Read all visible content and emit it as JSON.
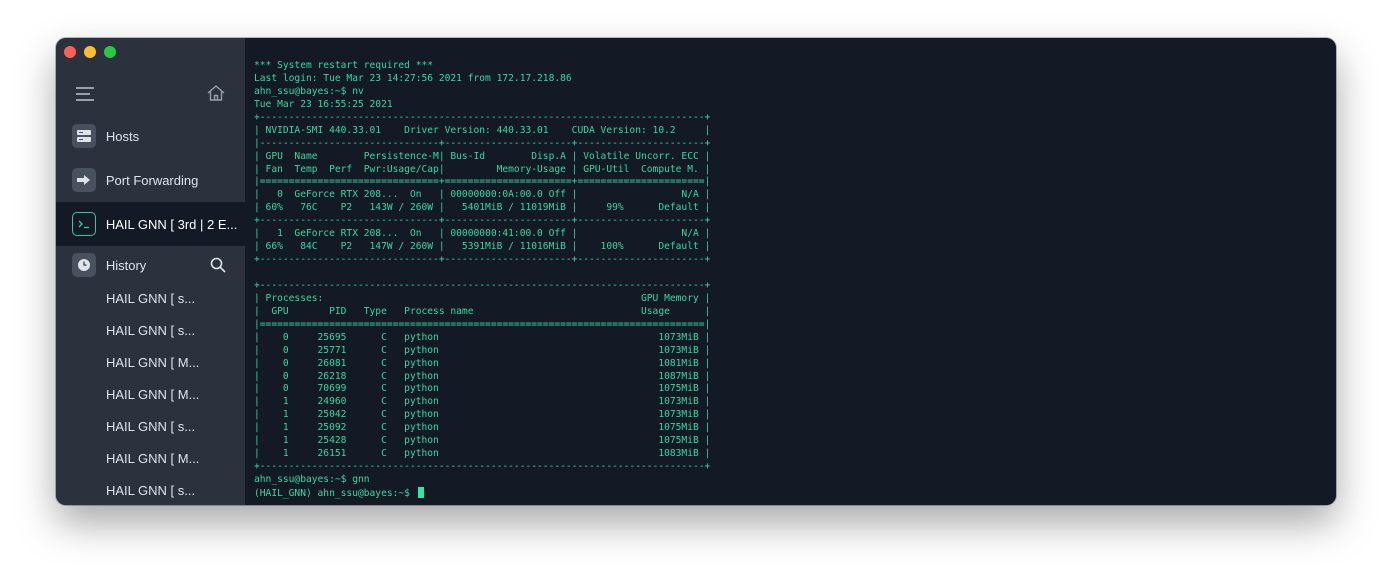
{
  "sidebar": {
    "nav": [
      {
        "label": "Hosts",
        "icon": "hosts-icon"
      },
      {
        "label": "Port Forwarding",
        "icon": "port-forwarding-icon"
      },
      {
        "label": "HAIL GNN [ 3rd | 2 E...",
        "icon": "terminal-icon",
        "active": true
      },
      {
        "label": "History",
        "icon": "history-icon"
      }
    ],
    "history": [
      "HAIL GNN [ s...",
      "HAIL GNN [ s...",
      "HAIL GNN [ M...",
      "HAIL GNN [ M...",
      "HAIL GNN [ s...",
      "HAIL GNN [ M...",
      "HAIL GNN [ s..."
    ]
  },
  "terminal": {
    "lines": [
      "*** System restart required ***",
      "Last login: Tue Mar 23 14:27:56 2021 from 172.17.218.86",
      "ahn_ssu@bayes:~$ nv",
      "Tue Mar 23 16:55:25 2021",
      "+-----------------------------------------------------------------------------+",
      "| NVIDIA-SMI 440.33.01    Driver Version: 440.33.01    CUDA Version: 10.2     |",
      "|-------------------------------+----------------------+----------------------+",
      "| GPU  Name        Persistence-M| Bus-Id        Disp.A | Volatile Uncorr. ECC |",
      "| Fan  Temp  Perf  Pwr:Usage/Cap|         Memory-Usage | GPU-Util  Compute M. |",
      "|===============================+======================+======================|",
      "|   0  GeForce RTX 208...  On   | 00000000:0A:00.0 Off |                  N/A |",
      "| 60%   76C    P2   143W / 260W |   5401MiB / 11019MiB |     99%      Default |",
      "+-------------------------------+----------------------+----------------------+",
      "|   1  GeForce RTX 208...  On   | 00000000:41:00.0 Off |                  N/A |",
      "| 66%   84C    P2   147W / 260W |   5391MiB / 11016MiB |    100%      Default |",
      "+-------------------------------+----------------------+----------------------+",
      "",
      "+-----------------------------------------------------------------------------+",
      "| Processes:                                                       GPU Memory |",
      "|  GPU       PID   Type   Process name                             Usage      |",
      "|=============================================================================|",
      "|    0     25695      C   python                                      1073MiB |",
      "|    0     25771      C   python                                      1073MiB |",
      "|    0     26081      C   python                                      1081MiB |",
      "|    0     26218      C   python                                      1087MiB |",
      "|    0     70699      C   python                                      1075MiB |",
      "|    1     24960      C   python                                      1073MiB |",
      "|    1     25042      C   python                                      1073MiB |",
      "|    1     25092      C   python                                      1075MiB |",
      "|    1     25428      C   python                                      1075MiB |",
      "|    1     26151      C   python                                      1083MiB |",
      "+-----------------------------------------------------------------------------+",
      "ahn_ssu@bayes:~$ gnn",
      "(HAIL_GNN) ahn_ssu@bayes:~$ "
    ]
  },
  "colors": {
    "terminal_text": "#33d9a0",
    "terminal_bg": "#141a25",
    "sidebar_bg": "#2b313d",
    "accent": "#2ecc9a"
  }
}
